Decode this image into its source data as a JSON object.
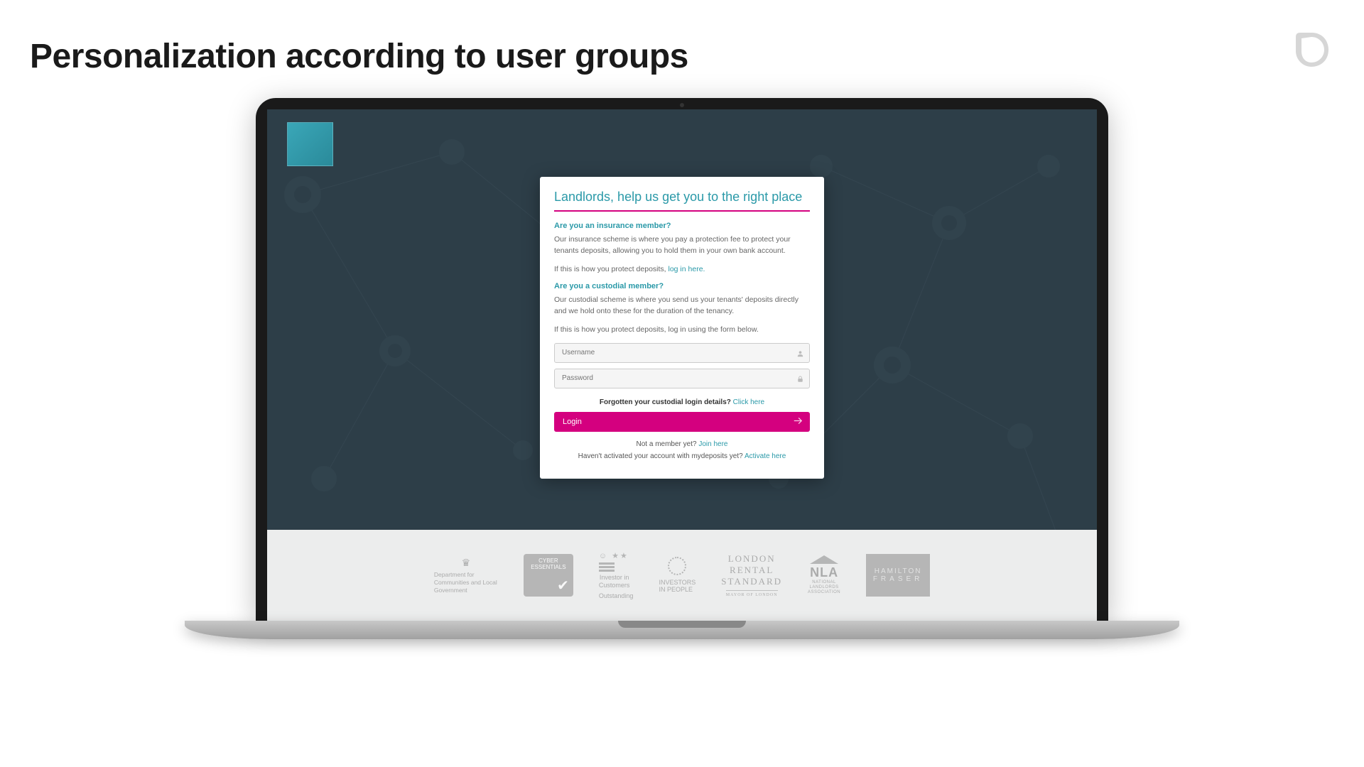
{
  "slide": {
    "title": "Personalization according to user groups"
  },
  "card": {
    "title": "Landlords, help us get you to the right place",
    "insurance_head": "Are you an insurance member?",
    "insurance_body": "Our insurance scheme is where you pay a protection fee to protect your tenants deposits, allowing you to hold them in your own bank account.",
    "insurance_prompt_prefix": "If this is how you protect deposits, ",
    "insurance_link": "log in here.",
    "custodial_head": "Are you a custodial member?",
    "custodial_body": "Our custodial scheme is where you send us your tenants' deposits directly and we hold onto these for the duration of the tenancy.",
    "custodial_prompt": "If this is how you protect deposits, log in using the form below.",
    "username_placeholder": "Username",
    "password_placeholder": "Password",
    "forgot_label": "Forgotten your custodial login details?",
    "forgot_link": "Click here",
    "login_button": "Login",
    "not_member_label": "Not a member yet?",
    "not_member_link": "Join here",
    "activate_label": "Haven't activated your account with mydeposits yet?",
    "activate_link": "Activate here"
  },
  "footer": {
    "partners": {
      "dept": "Department for Communities and Local Government",
      "cyber": "CYBER ESSENTIALS",
      "iic_line1": "Investor in",
      "iic_line2": "Customers",
      "iic_sub": "Outstanding",
      "iip_line1": "INVESTORS",
      "iip_line2": "IN PEOPLE",
      "lrs_1": "LONDON",
      "lrs_2": "RENTAL",
      "lrs_3": "STANDARD",
      "lrs_sub": "MAYOR OF LONDON",
      "nla_big": "NLA",
      "nla_s1": "NATIONAL",
      "nla_s2": "LANDLORDS",
      "nla_s3": "ASSOCIATION",
      "hf_1": "HAMILTON",
      "hf_2": "FRASER"
    }
  }
}
